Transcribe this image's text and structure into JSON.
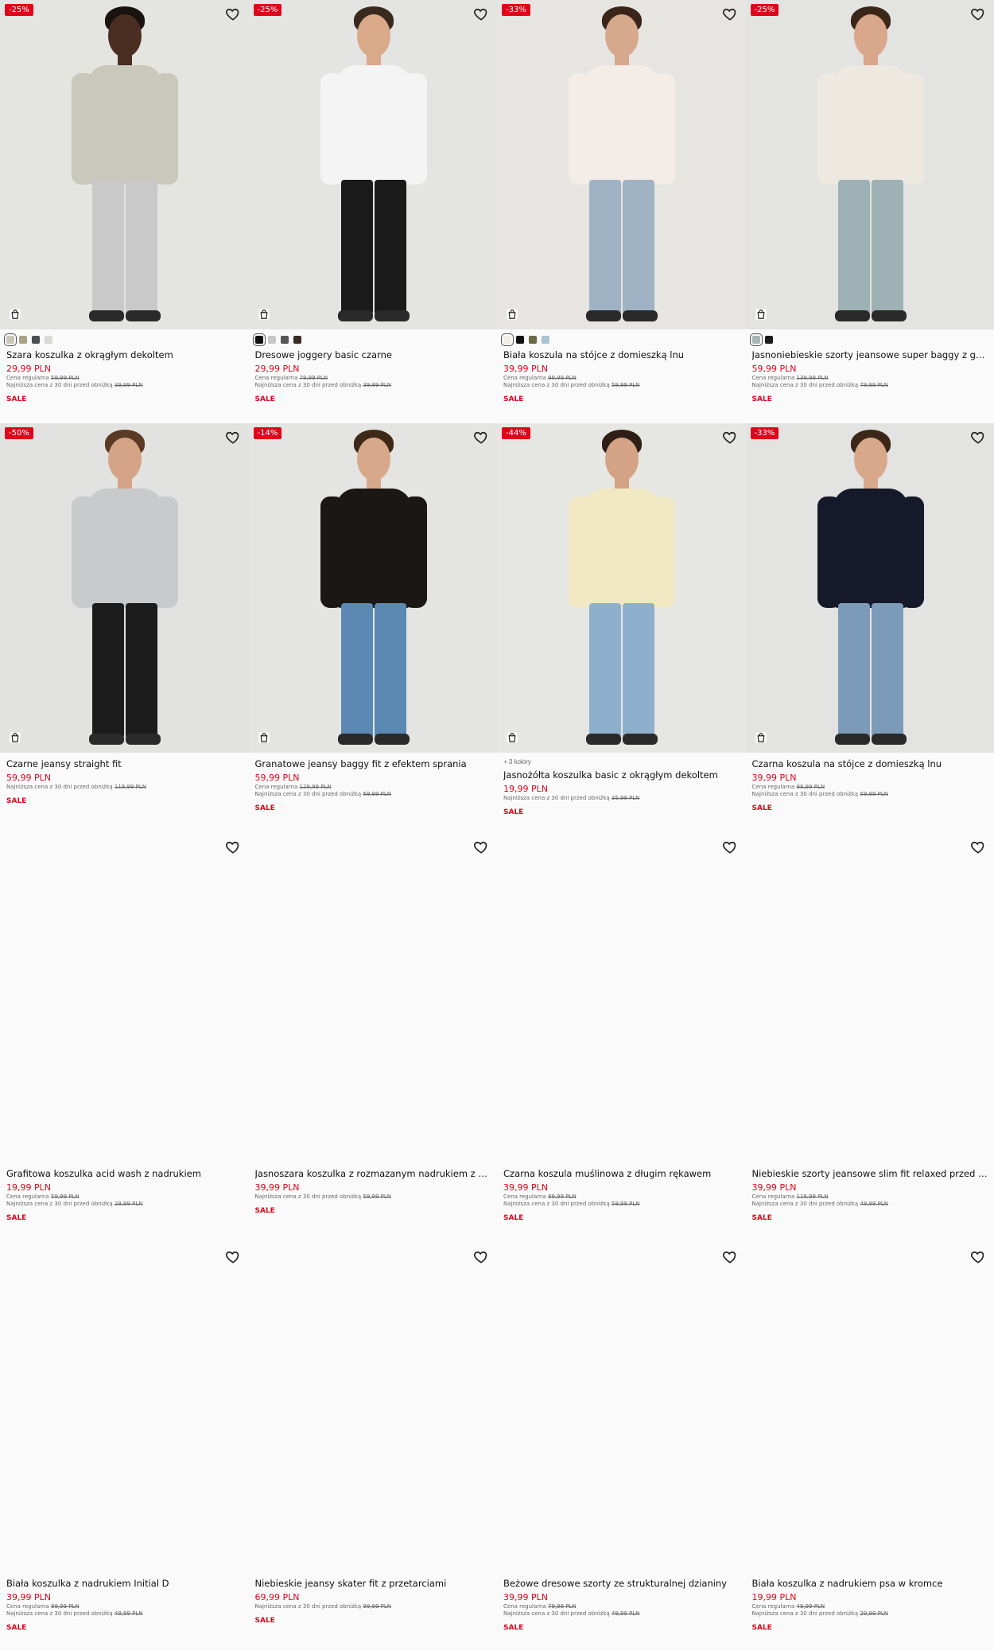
{
  "labels": {
    "regular": "Cena regularna",
    "lowest": "Najniższa cena z 30 dni przed obniżką",
    "sale": "SALE"
  },
  "products": [
    {
      "badge": "-25%",
      "name": "Szara koszulka z okrągłym dekoltem",
      "price": "29,99 PLN",
      "regular": "59,99 PLN",
      "lowest": "39,99 PLN",
      "swatches": [
        "#c9c7b8",
        "#a9a286",
        "#4b4d52",
        "#d9dad6"
      ],
      "selected": 0,
      "image": true,
      "colors": {
        "skin": "#4a2e22",
        "hair": "#1a1410",
        "top": "#c8c8bd",
        "legs": "#c9c9c9",
        "bg": "#e4e4e1"
      }
    },
    {
      "badge": "-25%",
      "name": "Dresowe joggery basic czarne",
      "price": "29,99 PLN",
      "regular": "79,99 PLN",
      "lowest": "39,99 PLN",
      "swatches": [
        "#111111",
        "#c7c7c7",
        "#555555",
        "#3a2a24"
      ],
      "selected": 0,
      "image": true,
      "colors": {
        "skin": "#d9a98a",
        "hair": "#3a2a1e",
        "top": "#f4f4f4",
        "legs": "#1a1a1a",
        "bg": "#e4e4e2"
      }
    },
    {
      "badge": "-33%",
      "name": "Biała koszula na stójce z domieszką lnu",
      "price": "39,99 PLN",
      "regular": "99,99 PLN",
      "lowest": "59,99 PLN",
      "swatches": [
        "#f2efe9",
        "#111111",
        "#6b6a48",
        "#a9c3d1"
      ],
      "selected": 0,
      "image": true,
      "colors": {
        "skin": "#d6a88c",
        "hair": "#3a2518",
        "top": "#f3ece7",
        "legs": "#9fb3c4",
        "bg": "#e6e5e2"
      }
    },
    {
      "badge": "-25%",
      "name": "Jasnoniebieskie szorty jeansowe super baggy z gwiazdka...",
      "price": "59,99 PLN",
      "regular": "139,99 PLN",
      "lowest": "79,99 PLN",
      "swatches": [
        "#a7b4b8",
        "#1b1b1b"
      ],
      "selected": 0,
      "image": true,
      "colors": {
        "skin": "#d8a78c",
        "hair": "#3b2618",
        "top": "#ede9e0",
        "legs": "#9eb1b5",
        "bg": "#e3e3e1"
      }
    },
    {
      "badge": "-50%",
      "name": "Czarne jeansy straight fit",
      "price": "59,99 PLN",
      "regular": "",
      "lowest": "119,99 PLN",
      "swatches": [],
      "image": true,
      "colors": {
        "skin": "#d5a487",
        "hair": "#5a3a24",
        "top": "#c9cacc",
        "legs": "#1c1c1c",
        "bg": "#e2e2e0"
      }
    },
    {
      "badge": "-14%",
      "name": "Granatowe jeansy baggy fit z efektem sprania",
      "price": "59,99 PLN",
      "regular": "129,99 PLN",
      "lowest": "69,99 PLN",
      "swatches": [],
      "image": true,
      "colors": {
        "skin": "#d7a88a",
        "hair": "#3e2818",
        "top": "#1b1715",
        "legs": "#5c89b4",
        "bg": "#e4e4e2"
      }
    },
    {
      "badge": "-44%",
      "name": "Jasnożółta koszulka basic z okrągłym dekoltem",
      "price": "19,99 PLN",
      "regular": "",
      "lowest": "35,99 PLN",
      "more": "+ 3 kolory",
      "swatches": [],
      "image": true,
      "colors": {
        "skin": "#d4a386",
        "hair": "#2e1e15",
        "top": "#f1e9c4",
        "legs": "#8fb0cc",
        "bg": "#e6e6e3"
      }
    },
    {
      "badge": "-33%",
      "name": "Czarna koszula na stójce z domieszką lnu",
      "price": "39,99 PLN",
      "regular": "99,99 PLN",
      "lowest": "59,99 PLN",
      "swatches": [],
      "image": true,
      "colors": {
        "skin": "#d8a88a",
        "hair": "#3b2618",
        "top": "#15192a",
        "legs": "#7c9bb8",
        "bg": "#e3e3e1"
      }
    },
    {
      "badge": "",
      "name": "Grafitowa koszulka acid wash z nadrukiem",
      "price": "19,99 PLN",
      "regular": "59,99 PLN",
      "lowest": "29,99 PLN",
      "swatches": [],
      "image": false
    },
    {
      "badge": "",
      "name": "Jasnoszara koszulka z rozmazanym nadrukiem z dżetami",
      "price": "39,99 PLN",
      "regular": "",
      "lowest": "59,99 PLN",
      "swatches": [],
      "image": false
    },
    {
      "badge": "",
      "name": "Czarna koszula muślinowa z długim rękawem",
      "price": "39,99 PLN",
      "regular": "89,99 PLN",
      "lowest": "59,99 PLN",
      "swatches": [],
      "image": false
    },
    {
      "badge": "",
      "name": "Niebieskie szorty jeansowe slim fit relaxed przed kolano",
      "price": "39,99 PLN",
      "regular": "119,99 PLN",
      "lowest": "49,99 PLN",
      "swatches": [],
      "image": false
    },
    {
      "badge": "",
      "name": "Biała koszulka z nadrukiem Initial D",
      "price": "39,99 PLN",
      "regular": "89,99 PLN",
      "lowest": "49,99 PLN",
      "swatches": [],
      "image": false
    },
    {
      "badge": "",
      "name": "Niebieskie jeansy skater fit z przetarciami",
      "price": "69,99 PLN",
      "regular": "",
      "lowest": "99,99 PLN",
      "swatches": [],
      "image": false
    },
    {
      "badge": "",
      "name": "Beżowe dresowe szorty ze strukturalnej dzianiny",
      "price": "39,99 PLN",
      "regular": "79,99 PLN",
      "lowest": "49,99 PLN",
      "swatches": [],
      "image": false
    },
    {
      "badge": "",
      "name": "Biała koszulka z nadrukiem psa w kromce",
      "price": "19,99 PLN",
      "regular": "49,99 PLN",
      "lowest": "29,99 PLN",
      "swatches": [],
      "image": false
    }
  ]
}
